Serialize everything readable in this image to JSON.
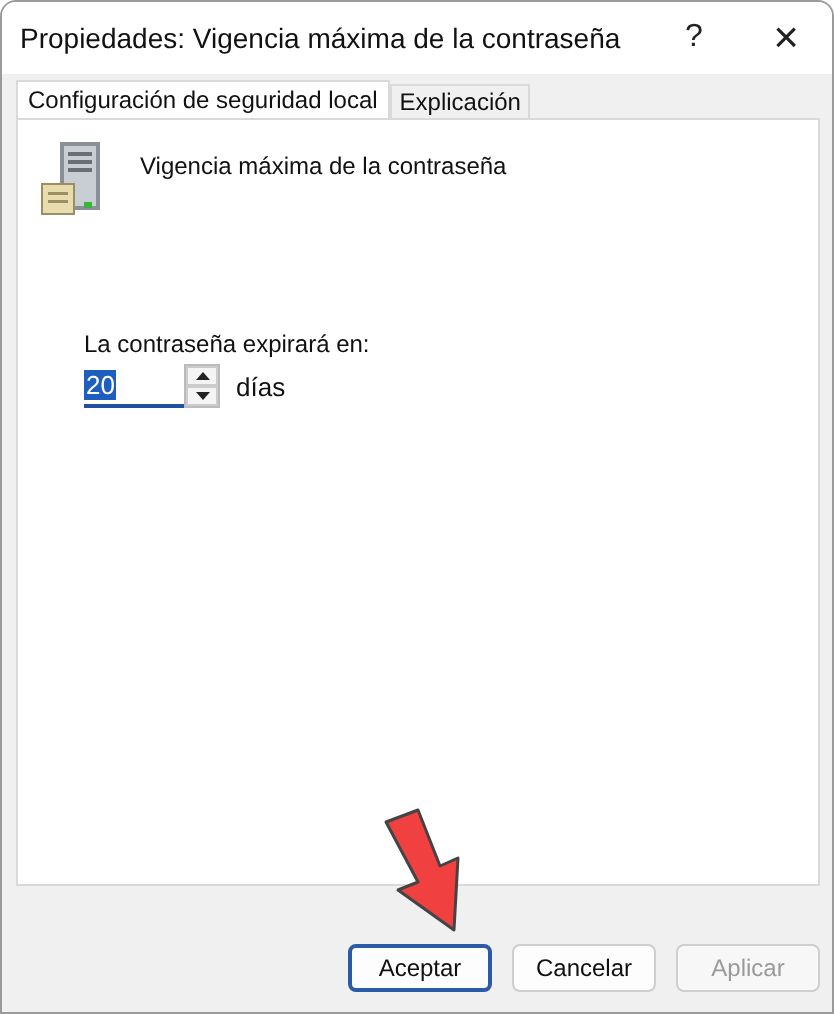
{
  "window": {
    "title": "Propiedades: Vigencia máxima de la contraseña",
    "help": "?",
    "close": "×"
  },
  "tabs": [
    {
      "label": "Configuración de seguridad local",
      "selected": true
    },
    {
      "label": "Explicación",
      "selected": false
    }
  ],
  "policy": {
    "name": "Vigencia máxima de la contraseña"
  },
  "expiry": {
    "label": "La contraseña expirará en:",
    "value": "20",
    "value_selected": true,
    "unit": "días"
  },
  "buttons": [
    {
      "label": "Aceptar",
      "default": true,
      "disabled": false
    },
    {
      "label": "Cancelar",
      "default": false,
      "disabled": false
    },
    {
      "label": "Aplicar",
      "default": false,
      "disabled": true
    }
  ]
}
